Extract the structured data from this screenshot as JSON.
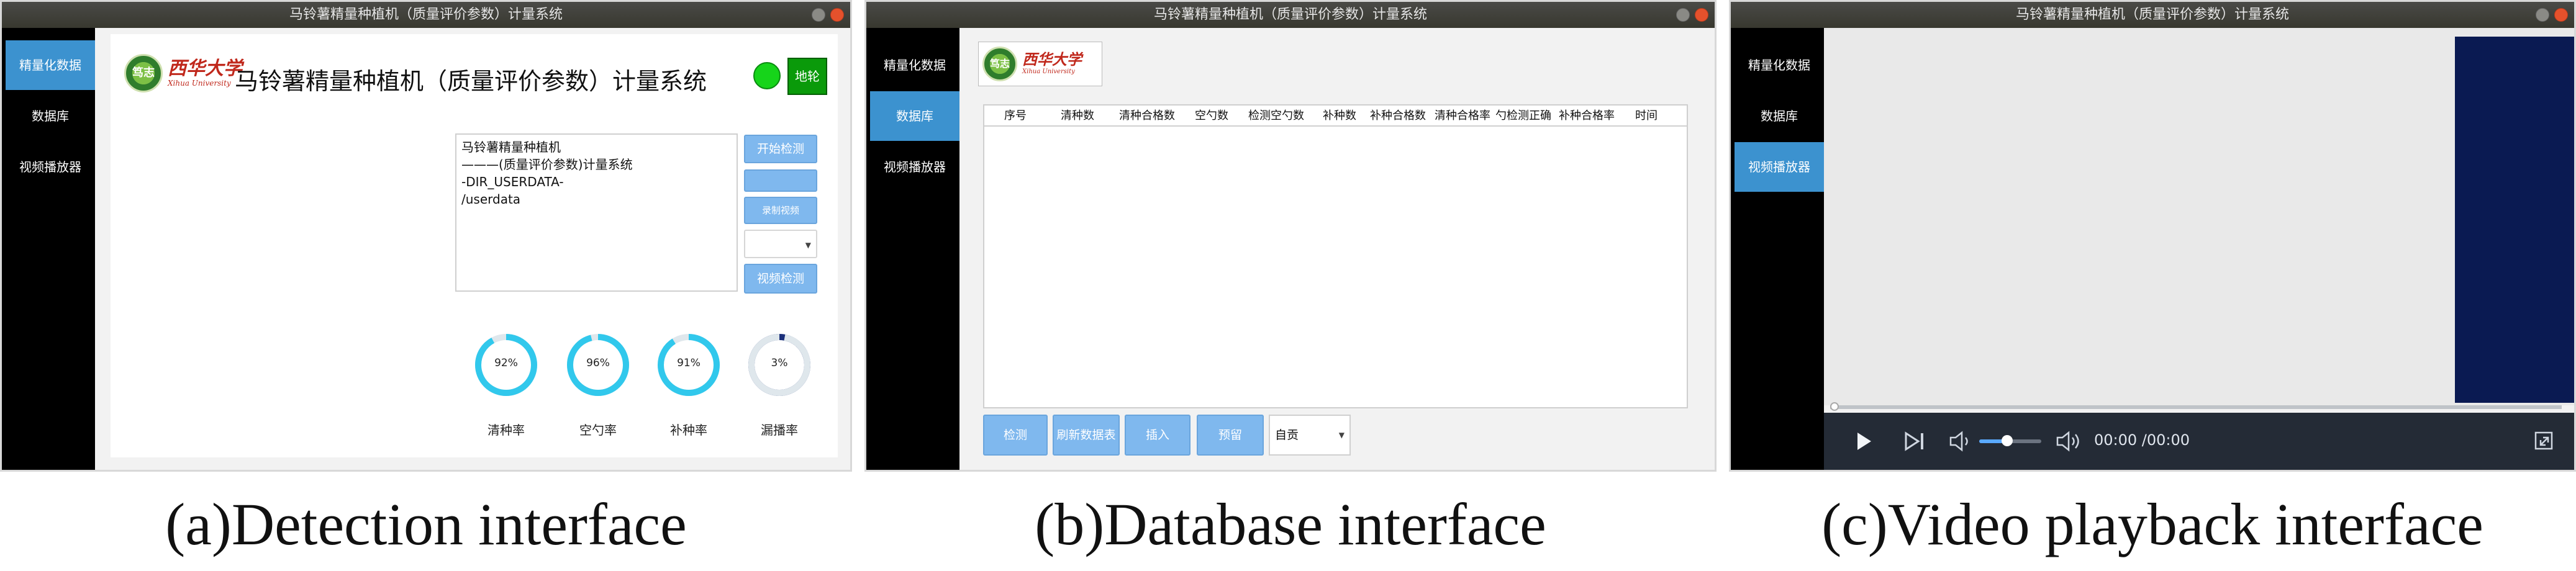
{
  "panel_a": {
    "window_title": "马铃薯精量种植机（质量评价参数）计量系统",
    "sidebar": [
      {
        "label": "精量化数据",
        "active": true
      },
      {
        "label": "数据库",
        "active": false
      },
      {
        "label": "视频播放器",
        "active": false
      }
    ],
    "logo": {
      "emblem_text": "笃志",
      "univ_cn": "西华大学",
      "univ_en": "Xihua University"
    },
    "app_title": "马铃薯精量种植机（质量评价参数）计量系统",
    "status_led_color": "#16d41a",
    "ground_wheel_button": "地轮",
    "info_lines": [
      "马铃薯精量种植机",
      "———(质量评价参数)计量系统",
      "-DIR_USERDATA-",
      "/userdata"
    ],
    "buttons": {
      "start_detection": "开始检测",
      "blank": "",
      "record_video": "录制视频",
      "video_detection": "视频检测"
    },
    "dropdown_value": "",
    "gauges": [
      {
        "label": "清种率",
        "value_text": "92%",
        "percent": 92,
        "color": "#31c8ec"
      },
      {
        "label": "空勺率",
        "value_text": "96%",
        "percent": 96,
        "color": "#31c8ec"
      },
      {
        "label": "补种率",
        "value_text": "91%",
        "percent": 91,
        "color": "#31c8ec"
      },
      {
        "label": "漏播率",
        "value_text": "3%",
        "percent": 3,
        "color": "#1a2f7a"
      }
    ],
    "caption": "(a)Detection interface"
  },
  "panel_b": {
    "window_title": "马铃薯精量种植机（质量评价参数）计量系统",
    "sidebar": [
      {
        "label": "精量化数据",
        "active": false
      },
      {
        "label": "数据库",
        "active": true
      },
      {
        "label": "视频播放器",
        "active": false
      }
    ],
    "logo": {
      "emblem_text": "笃志",
      "univ_cn": "西华大学",
      "univ_en": "Xihua University"
    },
    "columns": [
      "序号",
      "清种数",
      "清种合格数",
      "空勺数",
      "检测空勺数",
      "补种数",
      "补种合格数",
      "清种合格率",
      "勺检测正确",
      "补种合格率",
      "时间"
    ],
    "buttons": [
      "检测",
      "刷新数据表",
      "插入",
      "预留"
    ],
    "select_value": "自贡",
    "caption": "(b)Database interface"
  },
  "panel_c": {
    "window_title": "马铃薯精量种植机（质量评价参数）计量系统",
    "sidebar": [
      {
        "label": "精量化数据",
        "active": false
      },
      {
        "label": "数据库",
        "active": false
      },
      {
        "label": "视频播放器",
        "active": true
      }
    ],
    "time_display": "00:00 /00:00",
    "volume_fraction": 0.45,
    "playback_progress": 0,
    "icons": [
      "play-icon",
      "next-frame-icon",
      "volume-down-icon",
      "volume-up-icon",
      "fullscreen-icon"
    ],
    "caption": "(c)Video playback interface"
  }
}
